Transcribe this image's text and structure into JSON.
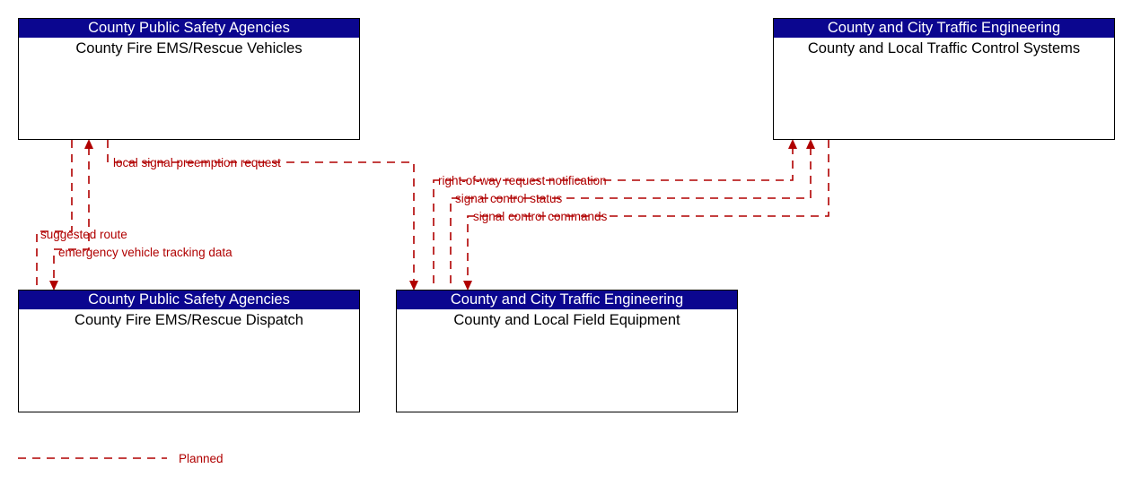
{
  "diagram": {
    "title": "",
    "accent_color": "#b00000",
    "header_color": "#0b068f",
    "nodes": [
      {
        "id": "county-fire-ems-rescue-vehicles",
        "stakeholder": "County Public Safety Agencies",
        "name": "County Fire EMS/Rescue Vehicles"
      },
      {
        "id": "county-and-local-traffic-control-systems",
        "stakeholder": "County and City Traffic Engineering",
        "name": "County and Local Traffic Control Systems"
      },
      {
        "id": "county-fire-ems-rescue-dispatch",
        "stakeholder": "County Public Safety Agencies",
        "name": "County Fire EMS/Rescue Dispatch"
      },
      {
        "id": "county-and-local-field-equipment",
        "stakeholder": "County and City Traffic Engineering",
        "name": "County and Local Field Equipment"
      }
    ],
    "flows": [
      {
        "id": "local-signal-preemption-request",
        "label": "local signal preemption request"
      },
      {
        "id": "right-of-way-request-notification",
        "label": "right-of-way request notification"
      },
      {
        "id": "signal-control-status",
        "label": "signal control status"
      },
      {
        "id": "signal-control-commands",
        "label": "signal control commands"
      },
      {
        "id": "suggested-route",
        "label": "suggested route"
      },
      {
        "id": "emergency-vehicle-tracking-data",
        "label": "emergency vehicle tracking data"
      }
    ],
    "legend": [
      {
        "id": "planned",
        "label": "Planned",
        "style": "dashed",
        "color": "#b00000"
      }
    ]
  }
}
